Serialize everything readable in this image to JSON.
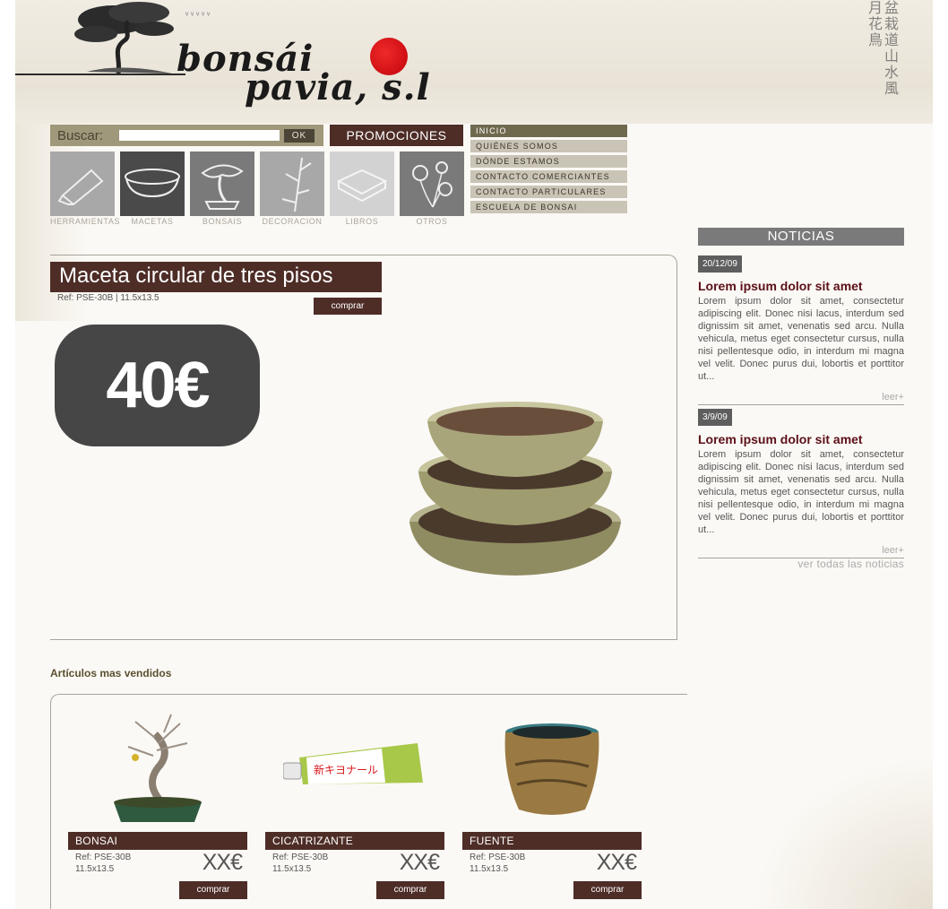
{
  "header": {
    "logo_line1": "bonsái",
    "logo_line2": "pavia, s.l"
  },
  "search": {
    "label": "Buscar:",
    "value": "",
    "placeholder": "",
    "ok_label": "OK"
  },
  "promo_button": "PROMOCIONES",
  "menu": {
    "items": [
      {
        "label": "INICIO",
        "active": true
      },
      {
        "label": "QUIÉNES SOMOS",
        "active": false
      },
      {
        "label": "DÓNDE ESTAMOS",
        "active": false
      },
      {
        "label": "CONTACTO COMERCIANTES",
        "active": false
      },
      {
        "label": "CONTACTO PARTICULARES",
        "active": false
      },
      {
        "label": "ESCUELA DE BONSAI",
        "active": false
      }
    ]
  },
  "categories": [
    {
      "label": "HERRAMIENTAS",
      "icon": "tool-tube-icon",
      "color": "#a8a8a8"
    },
    {
      "label": "MACETAS",
      "icon": "pot-icon",
      "color": "#4a4a4a"
    },
    {
      "label": "BONSAIS",
      "icon": "bonsai-tree-icon",
      "color": "#7a7a7a"
    },
    {
      "label": "DECORACION",
      "icon": "bamboo-icon",
      "color": "#a8a8a8"
    },
    {
      "label": "LIBROS",
      "icon": "book-icon",
      "color": "#d2d2d2"
    },
    {
      "label": "OTROS",
      "icon": "flowers-icon",
      "color": "#7a7a7a"
    }
  ],
  "featured": {
    "title": "Maceta circular de tres pisos",
    "ref": "Ref: PSE-30B | 11.5x13.5",
    "buy_label": "comprar",
    "price": "40€"
  },
  "news": {
    "header": "NOTICIAS",
    "items": [
      {
        "date": "20/12/09",
        "title": "Lorem ipsum dolor sit amet",
        "body": "Lorem ipsum dolor sit amet, consectetur adipiscing elit. Donec nisi lacus, interdum sed dignissim sit amet, venenatis sed arcu. Nulla vehicula, metus eget consectetur cursus, nulla nisi pellentesque odio, in interdum mi magna vel velit. Donec purus dui, lobortis et porttitor ut...",
        "more": "leer+"
      },
      {
        "date": "3/9/09",
        "title": "Lorem ipsum dolor sit amet",
        "body": "Lorem ipsum dolor sit amet, consectetur adipiscing elit. Donec nisi lacus, interdum sed dignissim sit amet, venenatis sed arcu. Nulla vehicula, metus eget consectetur cursus, nulla nisi pellentesque odio, in interdum mi magna vel velit. Donec purus dui, lobortis et porttitor ut...",
        "more": "leer+"
      }
    ],
    "all_link": "ver todas las noticias"
  },
  "bestsellers": {
    "title": "Artículos mas vendidos",
    "items": [
      {
        "name": "BONSAI",
        "ref": "Ref: PSE-30B",
        "size": "11.5x13.5",
        "price": "XX€",
        "buy_label": "comprar"
      },
      {
        "name": "CICATRIZANTE",
        "ref": "Ref: PSE-30B",
        "size": "11.5x13.5",
        "price": "XX€",
        "buy_label": "comprar",
        "tube_text": "新キヨナール"
      },
      {
        "name": "FUENTE",
        "ref": "Ref: PSE-30B",
        "size": "11.5x13.5",
        "price": "XX€",
        "buy_label": "comprar"
      }
    ]
  },
  "colors": {
    "brand_dark": "#4e2d27",
    "menu_active": "#6f6a4e",
    "news_title": "#5b0f17",
    "sun_red": "#d8161b"
  }
}
